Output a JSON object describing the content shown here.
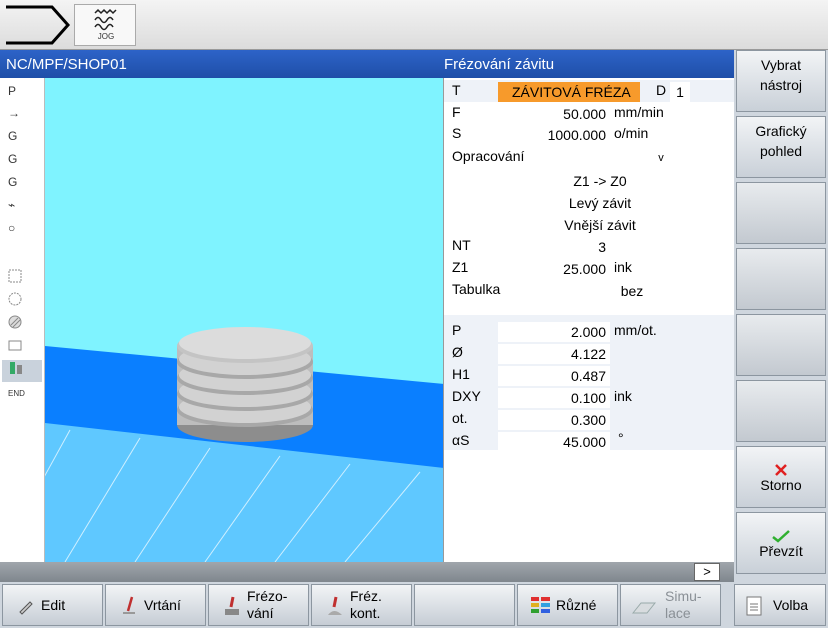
{
  "header": {
    "jog_label": "JOG"
  },
  "title_bar": {
    "path": "NC/MPF/SHOP01",
    "cycle_title": "Frézování závitu"
  },
  "left_icons": [
    "P",
    "→",
    "G",
    "G",
    "G",
    "⌁",
    "○",
    "",
    "",
    "",
    "",
    "",
    "",
    "",
    "END"
  ],
  "params": {
    "T_label": "T",
    "T_value": "ZÁVITOVÁ FRÉZA",
    "D_label": "D",
    "D_value": "1",
    "F_label": "F",
    "F_value": "50.000",
    "F_unit": "mm/min",
    "S_label": "S",
    "S_value": "1000.000",
    "S_unit": "o/min",
    "machining_label": "Opracování",
    "machining_value": "v",
    "direction": "Z1 -> Z0",
    "thread_hand": "Levý závit",
    "thread_type": "Vnější závit",
    "NT_label": "NT",
    "NT_value": "3",
    "Z1_label": "Z1",
    "Z1_value": "25.000",
    "Z1_unit": "ink",
    "table_label": "Tabulka",
    "table_value": "bez",
    "P_label": "P",
    "P_value": "2.000",
    "P_unit": "mm/ot.",
    "D_diam_label": "Ø",
    "D_diam_value": "4.122",
    "H1_label": "H1",
    "H1_value": "0.487",
    "DXY_label": "DXY",
    "DXY_value": "0.100",
    "DXY_unit": "ink",
    "ot_label": "ot.",
    "ot_value": "0.300",
    "aS_label": "αS",
    "aS_value": "45.000",
    "aS_unit": "°"
  },
  "softkeys_right": {
    "select_tool": [
      "Vybrat",
      "nástroj"
    ],
    "graphic_view": [
      "Grafický",
      "pohled"
    ],
    "cancel": "Storno",
    "accept": "Převzít"
  },
  "status": {
    "more": ">"
  },
  "softkeys_bottom": {
    "edit": "Edit",
    "drilling": "Vrtání",
    "milling": [
      "Frézo-",
      "vání"
    ],
    "contour_milling": [
      "Fréz.",
      "kont."
    ],
    "various": "Různé",
    "simulation": [
      "Simu-",
      "lace"
    ],
    "select": "Volba"
  },
  "colors": {
    "title_bar": "#2050b0",
    "tool_highlight": "#f79a2b",
    "viewport_sky": "#7ff3ff",
    "viewport_floor": "#0a7fff"
  }
}
